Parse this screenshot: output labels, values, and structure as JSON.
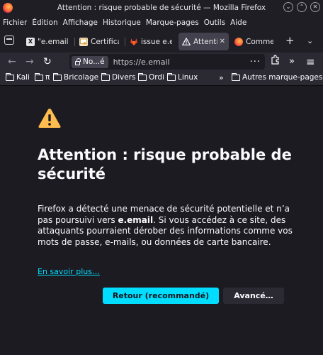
{
  "window": {
    "title": "Attention : risque probable de sécurité — Mozilla Firefox",
    "minimize_glyph": "⌄",
    "maximize_glyph": "⌃",
    "close_glyph": "✕"
  },
  "menu": [
    "Fichier",
    "Édition",
    "Affichage",
    "Historique",
    "Marque-pages",
    "Outils",
    "Aide"
  ],
  "tabs": [
    {
      "label": "\"e.email\"",
      "favicon": "x-icon",
      "favicon_color": "#15141a"
    },
    {
      "label": "Certificat",
      "favicon": "certificate-icon",
      "favicon_color": "#e8a23a"
    },
    {
      "label": "issue e.e",
      "favicon": "gitlab-icon",
      "favicon_color": "#e24329"
    },
    {
      "label": "Attenti",
      "favicon": "warning-icon",
      "favicon_color": "#fbfbfe",
      "active": true
    },
    {
      "label": "Commen",
      "favicon": "firefox-icon",
      "favicon_color": "#ff7139"
    }
  ],
  "tab_close_glyph": "✕",
  "new_tab_glyph": "+",
  "tab_overflow_glyph": "⌄",
  "navigation": {
    "back_glyph": "←",
    "forward_glyph": "→",
    "reload_glyph": "↻",
    "identity_label": "No...é",
    "url": "https://e.email",
    "page_actions_glyph": "···",
    "more_tools_glyph": "»",
    "menu_glyph": "≡"
  },
  "bookmarks": [
    "Kali",
    "π",
    "Bricolage",
    "Divers",
    "Ordi",
    "Linux"
  ],
  "bookmarks_more_glyph": "»",
  "other_bookmarks": "Autres marque-pages",
  "page": {
    "heading": "Attention : risque probable de sécurité",
    "desc_part1": "Firefox a détecté une menace de sécurité potentielle et n’a pas poursuivi vers ",
    "desc_bold": "e.email",
    "desc_part2": ". Si vous accédez à ce site, des attaquants pourraient dérober des informations comme vos mots de passe, e-mails, ou données de carte bancaire.",
    "learn_more": "En savoir plus…",
    "primary_button": "Retour (recommandé)",
    "secondary_button": "Avancé…"
  },
  "colors": {
    "accent": "#00ddff",
    "warning": "#ffbd4f",
    "background": "#1c1b22"
  }
}
